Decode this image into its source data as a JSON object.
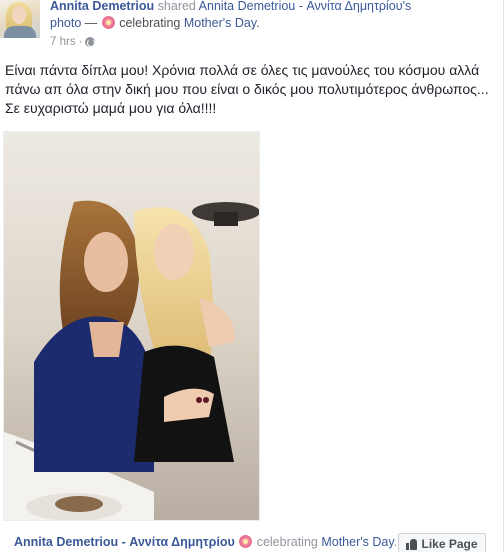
{
  "header": {
    "author": "Annita Demetriou",
    "shared_text": " shared ",
    "shared_from": "Annita Demetriou - Αννίτα Δημητρίου's",
    "photo_label": "photo",
    "dash": " — ",
    "celebrating": " celebrating ",
    "event": "Mother's Day",
    "period": ".",
    "time": "7 hrs",
    "separator": "·",
    "privacy_icon": "globe-icon",
    "feeling_icon": "flower-icon"
  },
  "post": {
    "text": "Είναι πάντα δίπλα μου! Χρόνια πολλά σε όλες τις μανούλες του κόσμου αλλά πάνω απ όλα στην δική μου που είναι ο δικός μου πολυτιμότερος άνθρωπος... Σε ευχαριστώ μαμά μου για όλα!!!!"
  },
  "footer": {
    "page_name": "Annita Demetriou - Αννίτα Δημητρίου",
    "celebrating": " celebrating ",
    "event": "Mother's Day",
    "period": ".",
    "like_page_label": "Like Page",
    "like_icon": "thumb-icon"
  },
  "colors": {
    "link": "#3b5998",
    "muted": "#90949c",
    "text": "#1d2129"
  }
}
